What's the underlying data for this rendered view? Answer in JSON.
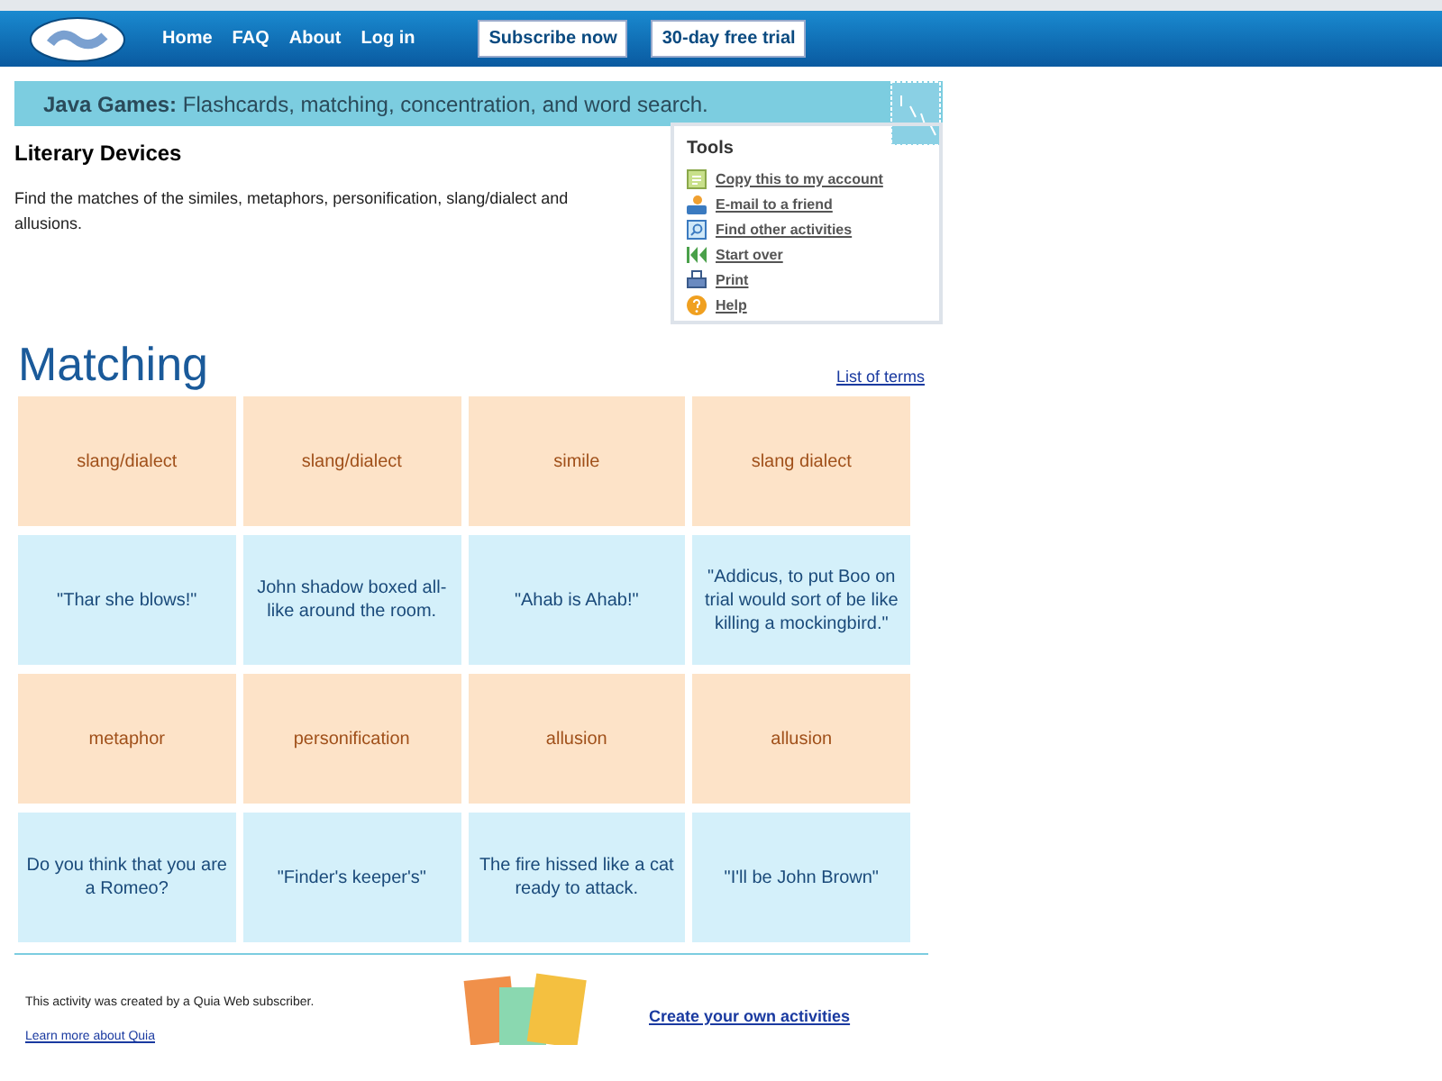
{
  "nav": {
    "links": [
      "Home",
      "FAQ",
      "About",
      "Log in"
    ],
    "buttons": [
      "Subscribe now",
      "30-day free trial"
    ]
  },
  "banner": {
    "text": "**Java Games:** Flashcards, matching, concentration, and word search."
  },
  "activity": {
    "title": "Literary Devices",
    "description": "Find the matches of the similes, metaphors, personification, slang/dialect and allusions."
  },
  "tools": {
    "title": "Tools",
    "items": [
      {
        "kind": "copy",
        "label": "Copy this to my account"
      },
      {
        "kind": "email",
        "label": "E-mail to a friend"
      },
      {
        "kind": "find",
        "label": "Find other activities"
      },
      {
        "kind": "restart",
        "label": "Start over"
      },
      {
        "kind": "print",
        "label": "Print"
      },
      {
        "kind": "help",
        "label": "Help"
      }
    ]
  },
  "matching": {
    "title": "Matching",
    "list_link": "List of terms",
    "rows": [
      [
        {
          "kind": "term",
          "text": "slang/dialect"
        },
        {
          "kind": "term",
          "text": "slang/dialect"
        },
        {
          "kind": "term",
          "text": "simile"
        },
        {
          "kind": "term",
          "text": "slang dialect"
        }
      ],
      [
        {
          "kind": "definition",
          "text": "\"Thar she blows!\""
        },
        {
          "kind": "definition",
          "text": "John shadow boxed all-like around the room."
        },
        {
          "kind": "definition",
          "text": "\"Ahab is Ahab!\""
        },
        {
          "kind": "definition",
          "text": "\"Addicus, to put Boo on trial would sort of be like killing a mockingbird.\""
        }
      ],
      [
        {
          "kind": "term",
          "text": "metaphor"
        },
        {
          "kind": "term",
          "text": "personification"
        },
        {
          "kind": "term",
          "text": "allusion"
        },
        {
          "kind": "term",
          "text": "allusion"
        }
      ],
      [
        {
          "kind": "definition",
          "text": "Do you think that you are a Romeo?"
        },
        {
          "kind": "definition",
          "text": "\"Finder's keeper's\""
        },
        {
          "kind": "definition",
          "text": "The fire hissed like a cat ready to attack."
        },
        {
          "kind": "definition",
          "text": "\"I'll be John Brown\""
        }
      ]
    ]
  },
  "footer": {
    "text": "This activity was created by a Quia Web subscriber.",
    "link": "Learn more about Quia",
    "create_link": "Create your own activities"
  }
}
